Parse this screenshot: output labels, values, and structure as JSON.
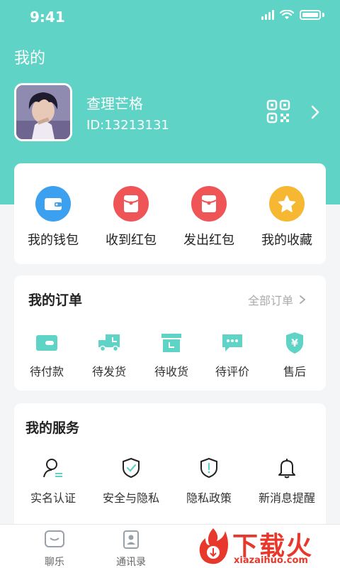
{
  "status_bar": {
    "time": "9:41"
  },
  "header": {
    "title": "我的"
  },
  "profile": {
    "name": "查理芒格",
    "id": "ID:13213131"
  },
  "wallet": {
    "items": [
      {
        "label": "我的钱包",
        "icon": "wallet-icon",
        "color": "#3aa0ef"
      },
      {
        "label": "收到红包",
        "icon": "red-envelope-icon",
        "color": "#ef5557"
      },
      {
        "label": "发出红包",
        "icon": "red-envelope-icon",
        "color": "#ef5557"
      },
      {
        "label": "我的收藏",
        "icon": "star-icon",
        "color": "#f6b733"
      }
    ]
  },
  "orders": {
    "title": "我的订单",
    "all_label": "全部订单",
    "items": [
      {
        "label": "待付款",
        "icon": "wallet-card-icon"
      },
      {
        "label": "待发货",
        "icon": "truck-icon"
      },
      {
        "label": "待收货",
        "icon": "box-icon"
      },
      {
        "label": "待评价",
        "icon": "comment-icon"
      },
      {
        "label": "售后",
        "icon": "yen-shield-icon"
      }
    ]
  },
  "services": {
    "title": "我的服务",
    "items": [
      {
        "label": "实名认证",
        "icon": "user-verify-icon"
      },
      {
        "label": "安全与隐私",
        "icon": "shield-check-icon"
      },
      {
        "label": "隐私政策",
        "icon": "shield-alert-icon"
      },
      {
        "label": "新消息提醒",
        "icon": "bell-icon"
      }
    ]
  },
  "tabbar": {
    "items": [
      {
        "label": "聊乐",
        "icon": "chat-icon"
      },
      {
        "label": "通讯录",
        "icon": "contacts-icon"
      }
    ]
  },
  "watermark": {
    "text": "下载火",
    "url": "xiazaihuo.com"
  },
  "colors": {
    "accent": "#5fd3c6",
    "order_icon": "#5fd3c6"
  }
}
